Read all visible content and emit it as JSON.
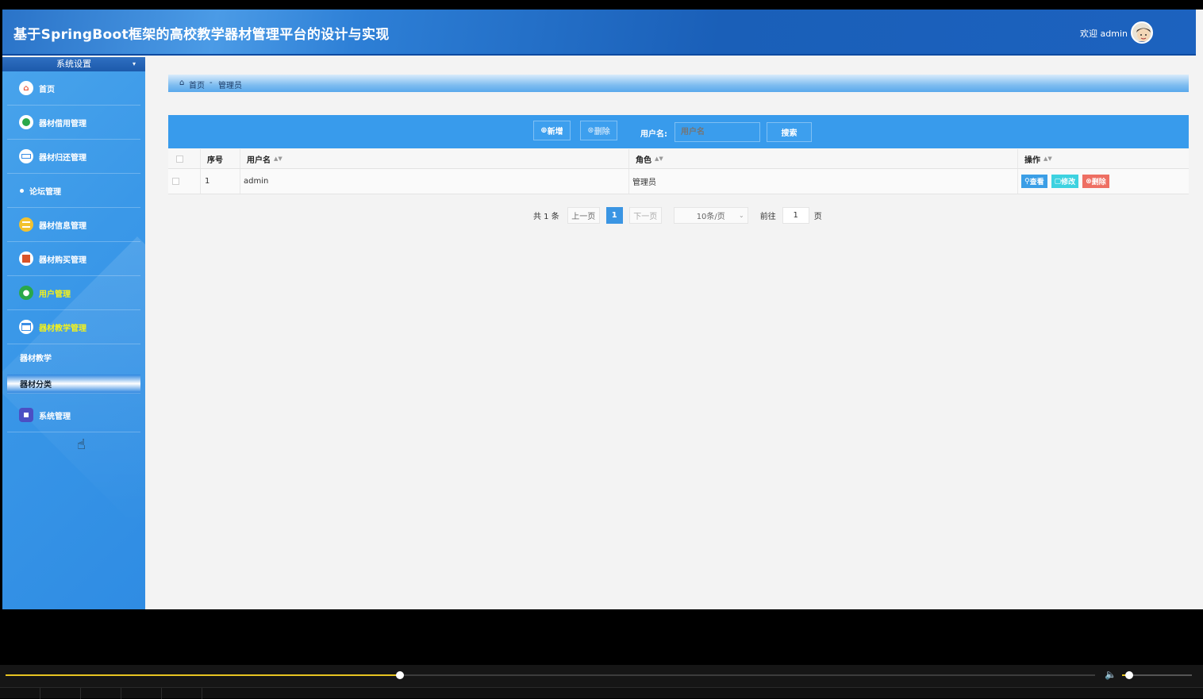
{
  "header": {
    "title": "基于SpringBoot框架的高校教学器材管理平台的设计与实现",
    "welcome": "欢迎 admin"
  },
  "sidebar": {
    "heading": "系统设置",
    "items": [
      {
        "label": "首页",
        "icon": "home-icon",
        "color": "#e8553a"
      },
      {
        "label": "器材借用管理",
        "icon": "minus-circle-icon",
        "color": "#2aa84a"
      },
      {
        "label": "器材归还管理",
        "icon": "return-icon",
        "color": "#3a8ee6"
      },
      {
        "label": "论坛管理",
        "icon": "dot-icon",
        "color": "#ffffff"
      },
      {
        "label": "器材信息管理",
        "icon": "database-icon",
        "color": "#e0a81c"
      },
      {
        "label": "器材购买管理",
        "icon": "book-icon",
        "color": "#d9542a"
      },
      {
        "label": "用户管理",
        "icon": "user-icon",
        "color": "#2aa84a"
      },
      {
        "label": "器材教学管理",
        "icon": "table-icon",
        "color": "#3a8ee6"
      }
    ],
    "sub_items": [
      "器材教学",
      "器材分类"
    ],
    "last_item": {
      "label": "系统管理",
      "icon": "system-icon",
      "color": "#4b4fc4"
    }
  },
  "breadcrumb": {
    "home": "首页",
    "separator": "-",
    "current": "管理员"
  },
  "toolbar": {
    "add_label": "新增",
    "delete_label": "删除",
    "username_label": "用户名:",
    "username_placeholder": "用户名",
    "search_label": "搜索"
  },
  "table": {
    "columns": [
      "序号",
      "用户名",
      "角色",
      "操作"
    ],
    "rows": [
      {
        "index": "1",
        "username": "admin",
        "role": "管理员"
      }
    ],
    "actions": {
      "view": "查看",
      "edit": "修改",
      "delete": "删除"
    }
  },
  "pagination": {
    "total": "共 1 条",
    "prev": "上一页",
    "current": "1",
    "next": "下一页",
    "page_size": "10条/页",
    "goto_label": "前往",
    "goto_value": "1",
    "page_suffix": "页"
  },
  "player": {
    "progress": 0.362,
    "volume": 0.1
  },
  "colors": {
    "accent": "#389bec",
    "view_button": "#3a9ee6",
    "edit_button": "#3dd2e0",
    "delete_button": "#ee6f63"
  }
}
